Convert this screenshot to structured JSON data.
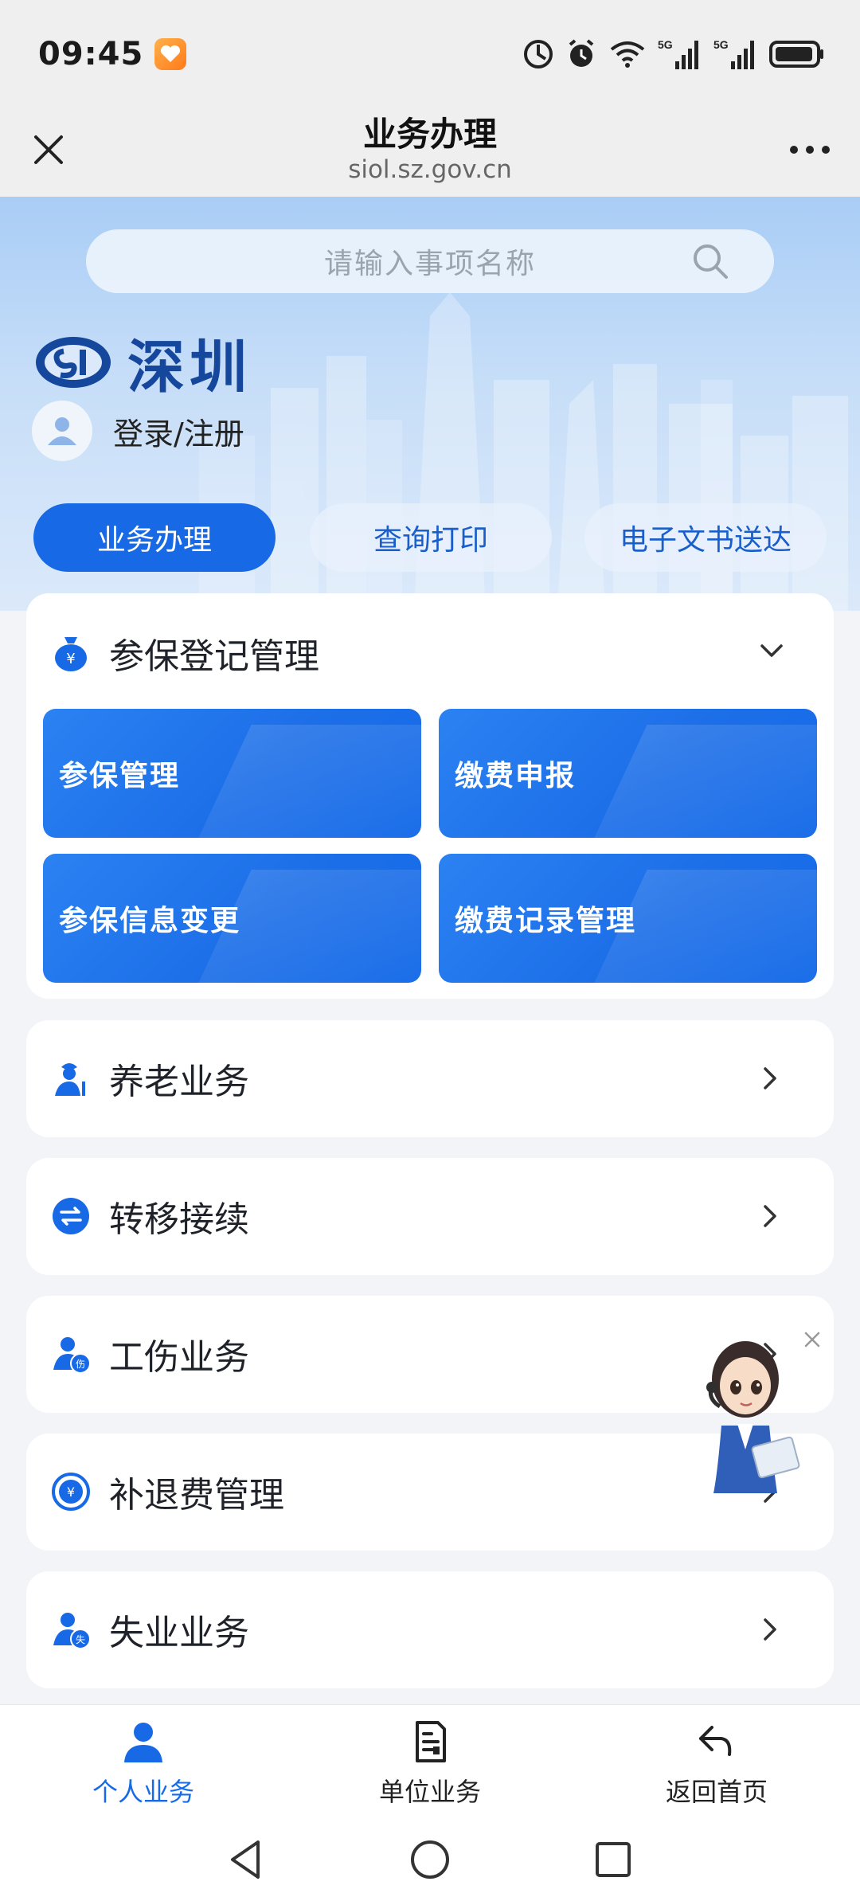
{
  "status_bar": {
    "time": "09:45",
    "icons": [
      "app-badge-icon",
      "data-saver-icon",
      "alarm-icon",
      "wifi-icon",
      "signal-5g-icon",
      "signal-5g-icon",
      "battery-icon"
    ],
    "network_label": "5G"
  },
  "title_bar": {
    "title": "业务办理",
    "url": "siol.sz.gov.cn"
  },
  "search": {
    "placeholder": "请输入事项名称"
  },
  "logo": {
    "text": "深圳"
  },
  "login": {
    "label": "登录/注册"
  },
  "tabs": [
    {
      "label": "业务办理",
      "active": true
    },
    {
      "label": "查询打印",
      "active": false
    },
    {
      "label": "电子文书送达",
      "active": false
    }
  ],
  "sections": {
    "expanded": {
      "title": "参保登记管理",
      "icon": "money-bag-icon",
      "tiles": [
        {
          "label": "参保管理"
        },
        {
          "label": "缴费申报"
        },
        {
          "label": "参保信息变更"
        },
        {
          "label": "缴费记录管理"
        }
      ]
    },
    "rows": [
      {
        "title": "养老业务",
        "icon": "elderly-person-icon"
      },
      {
        "title": "转移接续",
        "icon": "transfer-icon"
      },
      {
        "title": "工伤业务",
        "icon": "injury-person-icon"
      },
      {
        "title": "补退费管理",
        "icon": "refund-icon"
      },
      {
        "title": "失业业务",
        "icon": "unemployment-person-icon"
      }
    ]
  },
  "bottom_nav": [
    {
      "label": "个人业务",
      "icon": "person-icon",
      "active": true
    },
    {
      "label": "单位业务",
      "icon": "document-icon",
      "active": false
    },
    {
      "label": "返回首页",
      "icon": "return-icon",
      "active": false
    }
  ],
  "colors": {
    "primary": "#1769e6",
    "logo_blue": "#15479c",
    "hero_top": "#a9cdf6",
    "page_bg": "#f2f4f8"
  }
}
